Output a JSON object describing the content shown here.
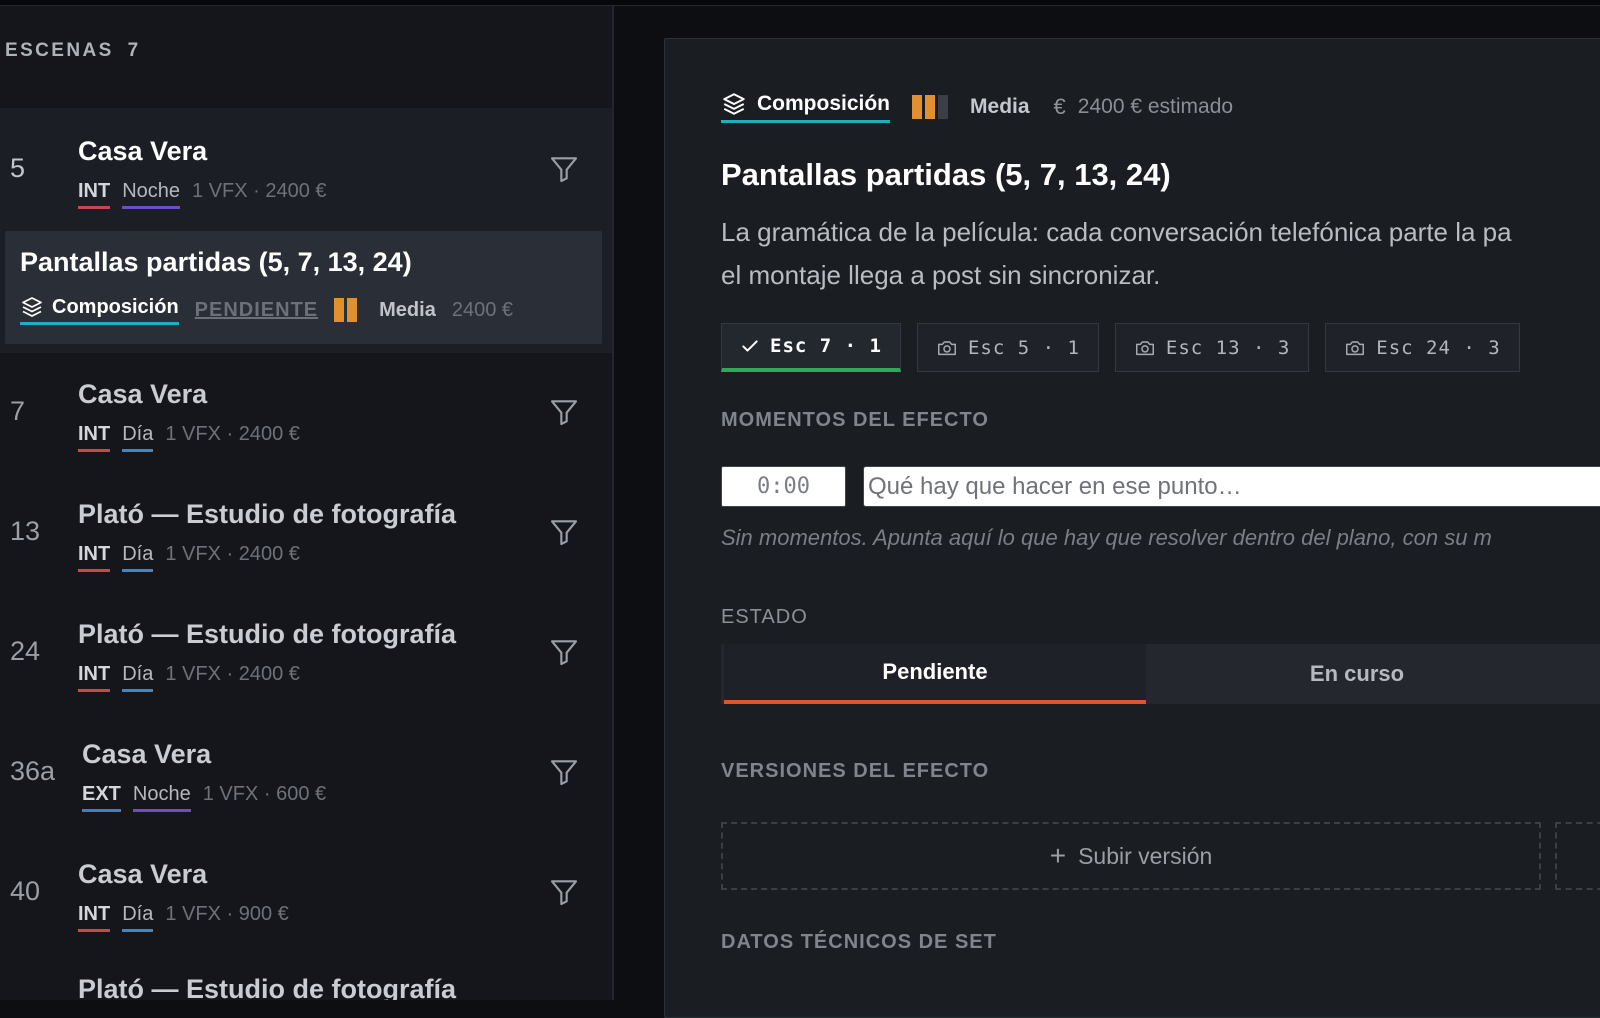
{
  "sidebar": {
    "header": "ESCENAS",
    "count": "7",
    "scenes": [
      {
        "num": "5",
        "title": "Casa Vera",
        "ie": "INT",
        "time": "Noche",
        "extra": "1 VFX · 2400 €"
      },
      {
        "num": "7",
        "title": "Casa Vera",
        "ie": "INT",
        "time": "Día",
        "extra": "1 VFX · 2400 €"
      },
      {
        "num": "13",
        "title": "Plató — Estudio de fotografía",
        "ie": "INT",
        "time": "Día",
        "extra": "1 VFX · 2400 €"
      },
      {
        "num": "24",
        "title": "Plató — Estudio de fotografía",
        "ie": "INT",
        "time": "Día",
        "extra": "1 VFX · 2400 €"
      },
      {
        "num": "36a",
        "title": "Casa Vera",
        "ie": "EXT",
        "time": "Noche",
        "extra": "1 VFX · 600 €"
      },
      {
        "num": "40",
        "title": "Casa Vera",
        "ie": "INT",
        "time": "Día",
        "extra": "1 VFX · 900 €"
      },
      {
        "num": "",
        "title": "Plató — Estudio de fotografía",
        "ie": "",
        "time": "",
        "extra": ""
      }
    ],
    "effect": {
      "title": "Pantallas partidas (5, 7, 13, 24)",
      "type": "Composición",
      "status": "PENDIENTE",
      "priority": "Media",
      "cost": "2400 €"
    }
  },
  "panel": {
    "type": "Composición",
    "priority": "Media",
    "currency_symbol": "€",
    "estimate": "2400 € estimado",
    "title": "Pantallas partidas (5, 7, 13, 24)",
    "desc_line1": "La gramática de la película: cada conversación telefónica parte la pa",
    "desc_line2": "el montaje llega a post sin sincronizar.",
    "shots": [
      {
        "label": "Esc 7 · 1",
        "icon": "check-icon",
        "selected": true
      },
      {
        "label": "Esc 5 · 1",
        "icon": "camera-icon",
        "selected": false
      },
      {
        "label": "Esc 13 · 3",
        "icon": "camera-icon",
        "selected": false
      },
      {
        "label": "Esc 24 · 3",
        "icon": "camera-icon",
        "selected": false
      }
    ],
    "moments_label": "MOMENTOS DEL EFECTO",
    "time_value": "0:00",
    "moment_placeholder": "Qué hay que hacer en ese punto…",
    "moments_hint": "Sin momentos. Apunta aquí lo que hay que resolver dentro del plano, con su m",
    "state_label": "ESTADO",
    "states": [
      "Pendiente",
      "En curso"
    ],
    "versions_label": "VERSIONES DEL EFECTO",
    "upload_label": "Subir versión",
    "tech_label": "DATOS TÉCNICOS DE SET"
  },
  "colors": {
    "int": "#c8474d",
    "ext": "#3f7fc6",
    "noche": "#6e4ec2",
    "dia": "#3f86c2",
    "composition": "#1faebd",
    "priority": "#e0902f",
    "selected_shot": "#2fa85a",
    "state_active": "#e0532e"
  }
}
